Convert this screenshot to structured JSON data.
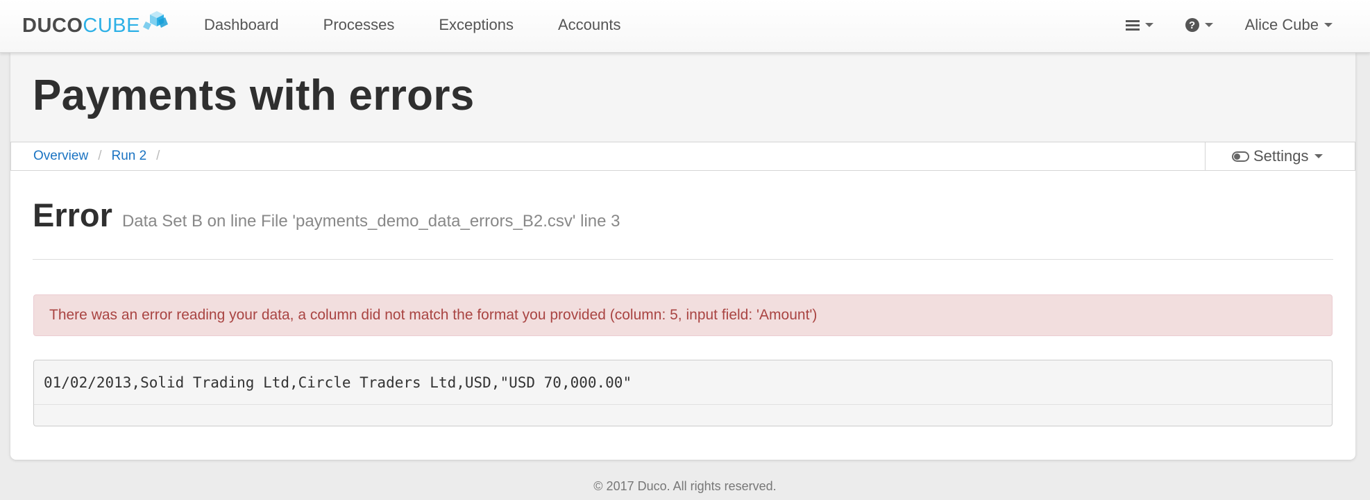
{
  "brand": {
    "part1": "DUCO",
    "part2": "CUBE"
  },
  "nav": {
    "links": [
      "Dashboard",
      "Processes",
      "Exceptions",
      "Accounts"
    ],
    "user": "Alice Cube",
    "help_glyph": "?"
  },
  "page": {
    "title": "Payments with errors"
  },
  "breadcrumb": {
    "items": [
      "Overview",
      "Run 2"
    ],
    "separator": "/"
  },
  "settings": {
    "label": "Settings"
  },
  "error": {
    "title": "Error",
    "subtitle": "Data Set B on line File 'payments_demo_data_errors_B2.csv' line 3",
    "message": "There was an error reading your data, a column did not match the format you provided (column: 5, input field: 'Amount')",
    "line": "01/02/2013,Solid Trading Ltd,Circle Traders Ltd,USD,\"USD 70,000.00\""
  },
  "footer": {
    "text": "© 2017 Duco. All rights reserved."
  },
  "colors": {
    "brand": "#2db0e6",
    "link": "#1a73c2",
    "alert_bg": "#f2dede",
    "alert_text": "#a94442"
  }
}
